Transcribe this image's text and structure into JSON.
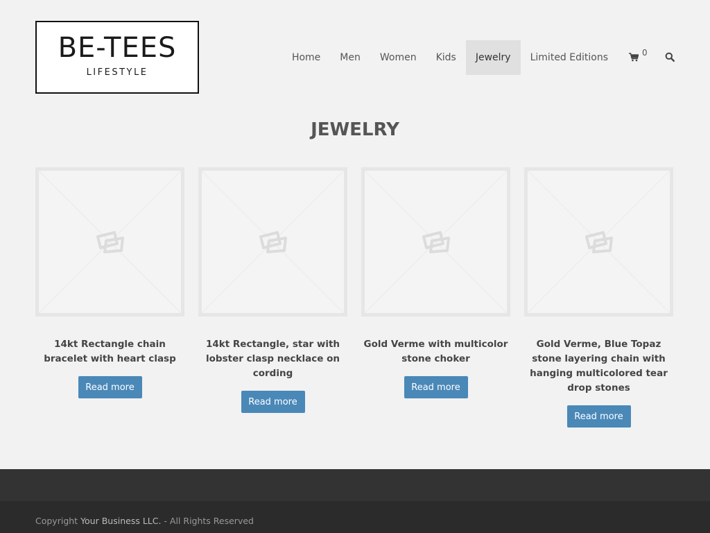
{
  "header": {
    "logo": {
      "title": "BE-TEES",
      "subtitle": "LIFESTYLE"
    },
    "nav": {
      "items": [
        {
          "label": "Home"
        },
        {
          "label": "Men"
        },
        {
          "label": "Women"
        },
        {
          "label": "Kids"
        },
        {
          "label": "Jewelry",
          "active": true
        },
        {
          "label": "Limited Editions"
        }
      ],
      "cart_count": "0",
      "cart_icon": "shopping-cart-icon",
      "search_icon": "search-icon"
    }
  },
  "main": {
    "title": "JEWELRY",
    "products": [
      {
        "name": "14kt Rectangle chain bracelet with heart clasp",
        "button": "Read more",
        "image_icon": "placeholder-image-icon"
      },
      {
        "name": "14kt Rectangle, star with lobster clasp necklace on cording",
        "button": "Read more",
        "image_icon": "placeholder-image-icon"
      },
      {
        "name": "Gold Verme with multicolor stone choker",
        "button": "Read more",
        "image_icon": "placeholder-image-icon"
      },
      {
        "name": "Gold Verme, Blue Topaz stone layering chain with hanging multicolored tear drop stones",
        "button": "Read more",
        "image_icon": "placeholder-image-icon"
      }
    ]
  },
  "footer": {
    "copyright_prefix": "Copyright ",
    "business": "Your Business LLC.",
    "copyright_suffix": " - All Rights Reserved"
  },
  "colors": {
    "page_bg": "#f2f2f2",
    "button": "#4a88b8",
    "active_nav_bg": "#e0e0e0",
    "footer_top": "#333333",
    "footer_bottom": "#2b2b2b"
  }
}
